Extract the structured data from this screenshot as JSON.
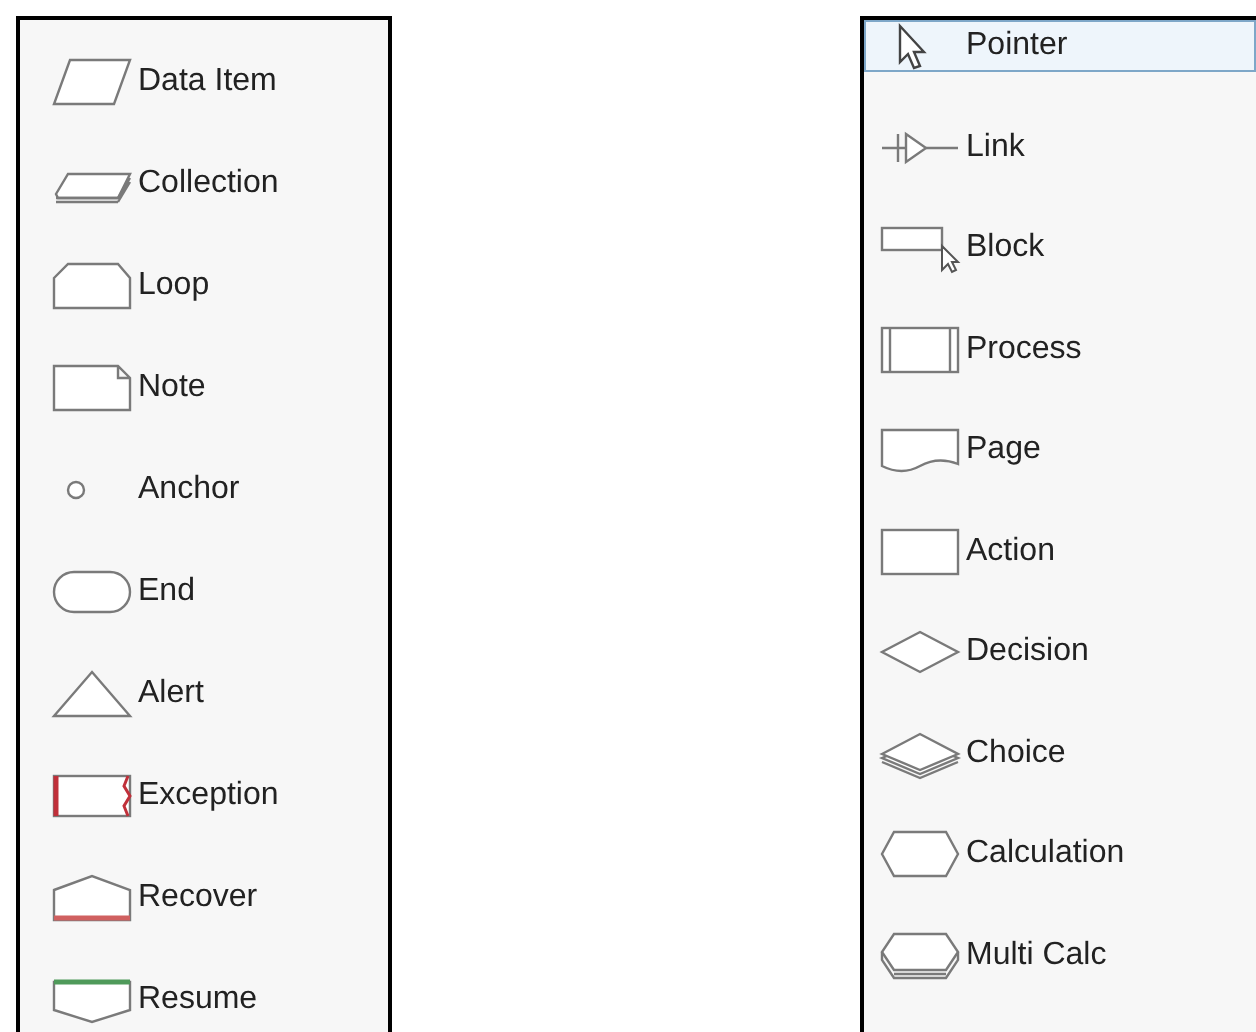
{
  "panels": [
    {
      "items": [
        {
          "label": "Data Item",
          "kind": "data-item",
          "selected": false
        },
        {
          "label": "Collection",
          "kind": "collection",
          "selected": false
        },
        {
          "label": "Loop",
          "kind": "loop",
          "selected": false
        },
        {
          "label": "Note",
          "kind": "note",
          "selected": false
        },
        {
          "label": "Anchor",
          "kind": "anchor",
          "selected": false
        },
        {
          "label": "End",
          "kind": "end",
          "selected": false
        },
        {
          "label": "Alert",
          "kind": "alert",
          "selected": false
        },
        {
          "label": "Exception",
          "kind": "exception",
          "selected": false
        },
        {
          "label": "Recover",
          "kind": "recover",
          "selected": false
        },
        {
          "label": "Resume",
          "kind": "resume",
          "selected": false
        }
      ]
    },
    {
      "items": [
        {
          "label": "Pointer",
          "kind": "pointer",
          "selected": true
        },
        {
          "label": "Link",
          "kind": "link",
          "selected": false
        },
        {
          "label": "Block",
          "kind": "block",
          "selected": false
        },
        {
          "label": "Process",
          "kind": "process",
          "selected": false
        },
        {
          "label": "Page",
          "kind": "page",
          "selected": false
        },
        {
          "label": "Action",
          "kind": "action",
          "selected": false
        },
        {
          "label": "Decision",
          "kind": "decision",
          "selected": false
        },
        {
          "label": "Choice",
          "kind": "choice",
          "selected": false
        },
        {
          "label": "Calculation",
          "kind": "calculation",
          "selected": false
        },
        {
          "label": "Multi Calc",
          "kind": "multi-calc",
          "selected": false
        }
      ]
    }
  ]
}
